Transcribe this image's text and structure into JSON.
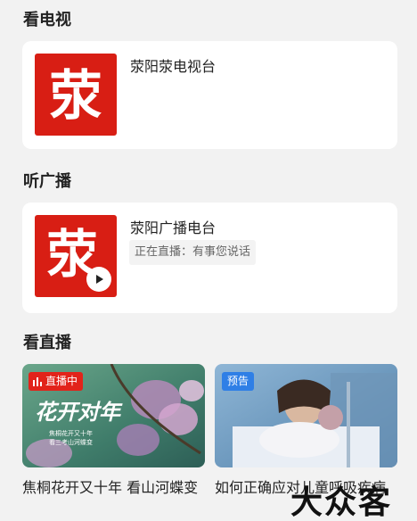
{
  "tv_section": {
    "title": "看电视",
    "station": {
      "name": "荥阳荥电视台",
      "logo_char": "荥"
    }
  },
  "radio_section": {
    "title": "听广播",
    "station": {
      "name": "荥阳广播电台",
      "now_playing": "正在直播：有事您说话",
      "logo_char": "荥"
    }
  },
  "live_section": {
    "title": "看直播",
    "items": [
      {
        "badge": "直播中",
        "caption": "焦桐花开又十年 看山河蝶变",
        "thumb_title": "花开对年",
        "thumb_subtitle_1": "焦桐花开又十年",
        "thumb_subtitle_2": "看三考山河蝶变"
      },
      {
        "badge": "预告",
        "caption": "如何正确应对儿童呼吸疾病"
      }
    ]
  },
  "watermark": "大众客",
  "colors": {
    "brand_red": "#d81e14",
    "live_red": "#e2231a",
    "preview_blue": "#2f7fe6"
  }
}
